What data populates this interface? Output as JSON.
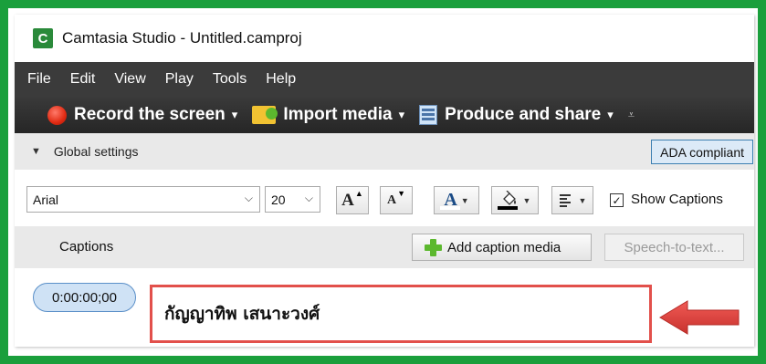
{
  "window": {
    "title": "Camtasia Studio - Untitled.camproj",
    "icon_letter": "C"
  },
  "menu": {
    "items": [
      "File",
      "Edit",
      "View",
      "Play",
      "Tools",
      "Help"
    ]
  },
  "toolbar": {
    "record_label": "Record the screen",
    "import_label": "Import media",
    "produce_label": "Produce and share",
    "caret": "▾",
    "overflow": "⩡"
  },
  "global_settings": {
    "label": "Global settings",
    "collapse_glyph": "▼",
    "ada_label": "ADA compliant"
  },
  "font_settings": {
    "font_family_value": "Arial",
    "font_size_value": "20",
    "increase_label": "A",
    "decrease_label": "A",
    "font_color_label": "A",
    "font_color": "#ffffff",
    "fill_color": "#000000",
    "show_captions_label": "Show Captions",
    "show_captions_checked": "✓"
  },
  "captions_header": {
    "label": "Captions",
    "add_media_label": "Add caption media",
    "speech_to_text_label": "Speech-to-text..."
  },
  "caption_entry": {
    "timecode": "0:00:00;00",
    "text": "กัญญาทิพ เสนาะวงศ์"
  },
  "colors": {
    "frame": "#1a9f3c",
    "highlight": "#e2504b",
    "accent": "#3c7fb1"
  }
}
